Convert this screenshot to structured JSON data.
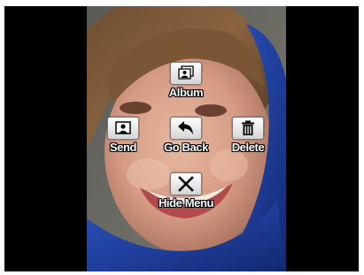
{
  "photo": {
    "description_icon": "portrait-photo"
  },
  "menu": {
    "items": [
      {
        "label": "Album",
        "icon": "album-icon"
      },
      {
        "label": "Send",
        "icon": "send-icon"
      },
      {
        "label": "Go Back",
        "icon": "go-back-icon"
      },
      {
        "label": "Delete",
        "icon": "trash-icon"
      },
      {
        "label": "Hide Menu",
        "icon": "close-icon"
      }
    ]
  },
  "colors": {
    "screen_background": "#000000",
    "label_text": "#ffffff",
    "scarf_blue": "#1f3f9c"
  }
}
